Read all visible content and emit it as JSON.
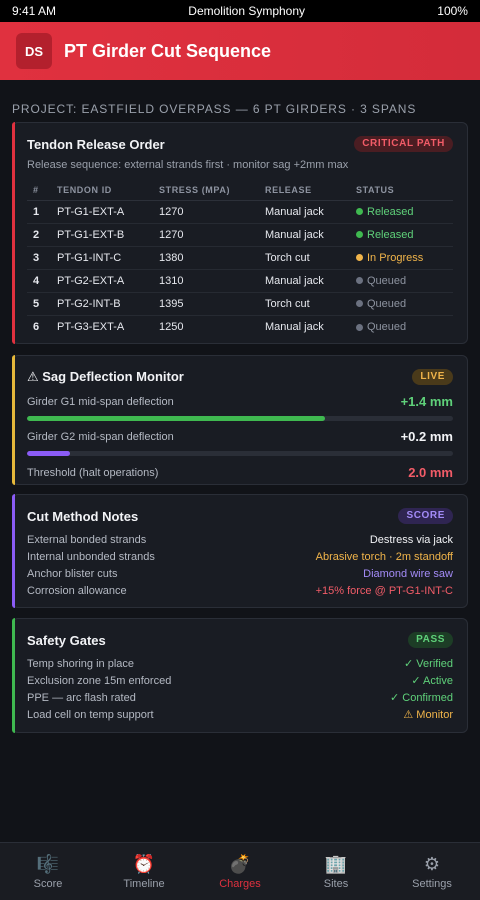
{
  "status_bar": {
    "time": "9:41 AM",
    "title": "Demolition Symphony",
    "battery": "100%"
  },
  "header": {
    "logo": "DS",
    "title": "PT Girder Cut Sequence"
  },
  "project_line": "PROJECT: EASTFIELD OVERPASS — 6 PT GIRDERS · 3 SPANS",
  "tendon_card": {
    "title": "Tendon Release Order",
    "badge": "CRITICAL PATH",
    "subtitle": "Release sequence: external strands first · monitor sag +2mm max",
    "columns": [
      "#",
      "TENDON ID",
      "STRESS (MPA)",
      "RELEASE",
      "STATUS"
    ],
    "rows": [
      {
        "num": "1",
        "id": "PT-G1-EXT-A",
        "stress": "1270",
        "release": "Manual jack",
        "status": "Released",
        "state": "released"
      },
      {
        "num": "2",
        "id": "PT-G1-EXT-B",
        "stress": "1270",
        "release": "Manual jack",
        "status": "Released",
        "state": "released"
      },
      {
        "num": "3",
        "id": "PT-G1-INT-C",
        "stress": "1380",
        "release": "Torch cut",
        "status": "In Progress",
        "state": "progress"
      },
      {
        "num": "4",
        "id": "PT-G2-EXT-A",
        "stress": "1310",
        "release": "Manual jack",
        "status": "Queued",
        "state": "queued"
      },
      {
        "num": "5",
        "id": "PT-G2-INT-B",
        "stress": "1395",
        "release": "Torch cut",
        "status": "Queued",
        "state": "queued"
      },
      {
        "num": "6",
        "id": "PT-G3-EXT-A",
        "stress": "1250",
        "release": "Manual jack",
        "status": "Queued",
        "state": "queued"
      }
    ]
  },
  "sag_card": {
    "title": "⚠ Sag Deflection Monitor",
    "badge": "LIVE",
    "g1_label": "Girder G1 mid-span deflection",
    "g1_value": "+1.4 mm",
    "g1_fraction": 0.7,
    "g2_label": "Girder G2 mid-span deflection",
    "g2_value": "+0.2 mm",
    "g2_fraction": 0.1,
    "threshold_label": "Threshold (halt operations)",
    "threshold_value": "2.0 mm"
  },
  "cut_card": {
    "title": "Cut Method Notes",
    "badge": "SCORE",
    "items": [
      {
        "label": "External bonded strands",
        "value": "Destress via jack",
        "color": "#f2f3f6"
      },
      {
        "label": "Internal unbonded strands",
        "value": "Abrasive torch · 2m standoff",
        "color": "#f0b44a"
      },
      {
        "label": "Anchor blister cuts",
        "value": "Diamond wire saw",
        "color": "#a38bf7"
      },
      {
        "label": "Corrosion allowance",
        "value": "+15% force @ PT-G1-INT-C",
        "color": "#f25c68"
      }
    ]
  },
  "safety_card": {
    "title": "Safety Gates",
    "badge": "PASS",
    "items": [
      {
        "label": "Temp shoring in place",
        "value": "✓ Verified",
        "color": "#5fd17a"
      },
      {
        "label": "Exclusion zone 15m enforced",
        "value": "✓ Active",
        "color": "#5fd17a"
      },
      {
        "label": "PPE — arc flash rated",
        "value": "✓ Confirmed",
        "color": "#5fd17a"
      },
      {
        "label": "Load cell on temp support",
        "value": "⚠ Monitor",
        "color": "#f0b44a"
      }
    ]
  },
  "nav": [
    {
      "icon": "🎼",
      "label": "Score",
      "active": false
    },
    {
      "icon": "⏰",
      "label": "Timeline",
      "active": false
    },
    {
      "icon": "💣",
      "label": "Charges",
      "active": true
    },
    {
      "icon": "🏢",
      "label": "Sites",
      "active": false
    },
    {
      "icon": "⚙",
      "label": "Settings",
      "active": false
    }
  ]
}
